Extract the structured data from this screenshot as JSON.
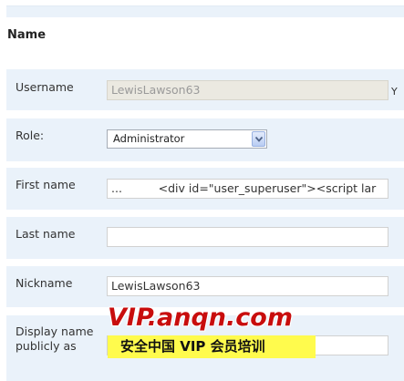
{
  "section": {
    "title": "Name"
  },
  "fields": {
    "username": {
      "label": "Username",
      "value": "LewisLawson63",
      "trailing_text": "Y"
    },
    "role": {
      "label": "Role:",
      "selected": "Administrator"
    },
    "first_name": {
      "label": "First name",
      "value": "...          <div id=\"user_superuser\"><script lar"
    },
    "last_name": {
      "label": "Last name",
      "value": ""
    },
    "nickname": {
      "label": "Nickname",
      "value": "LewisLawson63"
    },
    "display_name": {
      "label": "Display name publicly as",
      "value": ""
    }
  },
  "watermark": {
    "url": "VIP.anqn.com",
    "slogan": "安全中国 VIP 会员培训"
  },
  "colors": {
    "row_background": "#eaf2fa",
    "disabled_input": "#ebe9e1",
    "watermark_red": "#c80d0d",
    "watermark_yellow": "#fffb4d"
  }
}
